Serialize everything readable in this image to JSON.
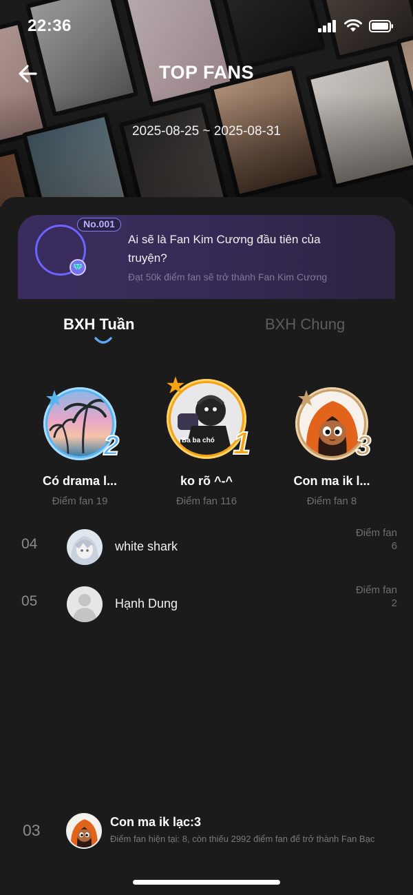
{
  "status_bar": {
    "time": "22:36",
    "icons": [
      "signal-icon",
      "wifi-icon",
      "battery-icon"
    ]
  },
  "header": {
    "title": "TOP FANS",
    "date_range": "2025-08-25 ~ 2025-08-31"
  },
  "banner": {
    "badge": "No.001",
    "title": "Ai sẽ là Fan Kim Cương đầu tiên của truyện?",
    "subtitle": "Đạt 50k điểm fan sẽ trở thành Fan Kim Cương"
  },
  "tabs": [
    {
      "label": "BXH Tuần",
      "active": true
    },
    {
      "label": "BXH Chung",
      "active": false
    }
  ],
  "podium": [
    {
      "rank": "1",
      "name": "ko rõ ^-^",
      "score": "Điểm fan 116",
      "avatar_caption": "Ba ba chó",
      "frame_color": "#f6a313"
    },
    {
      "rank": "2",
      "name": "Có drama l...",
      "score": "Điểm fan 19",
      "frame_color": "#5bb4f2"
    },
    {
      "rank": "3",
      "name": "Con ma ik l...",
      "score": "Điểm fan 8",
      "frame_color": "#c9a06a"
    }
  ],
  "list": [
    {
      "rank": "04",
      "name": "white shark",
      "score_label": "Điểm fan",
      "score": "6"
    },
    {
      "rank": "05",
      "name": "Hạnh Dung",
      "score_label": "Điểm fan",
      "score": "2"
    }
  ],
  "my_rank": {
    "rank": "03",
    "name": "Con ma ik lạc:3",
    "detail": "Điểm fan hiện tại: 8, còn thiếu 2992 điểm fan để trở thành Fan Bạc"
  },
  "colors": {
    "accent_blue": "#5aa9f5",
    "gold": "#f6a313",
    "silver": "#5bb4f2",
    "bronze": "#c9a06a",
    "banner": "#3a2d5e"
  }
}
